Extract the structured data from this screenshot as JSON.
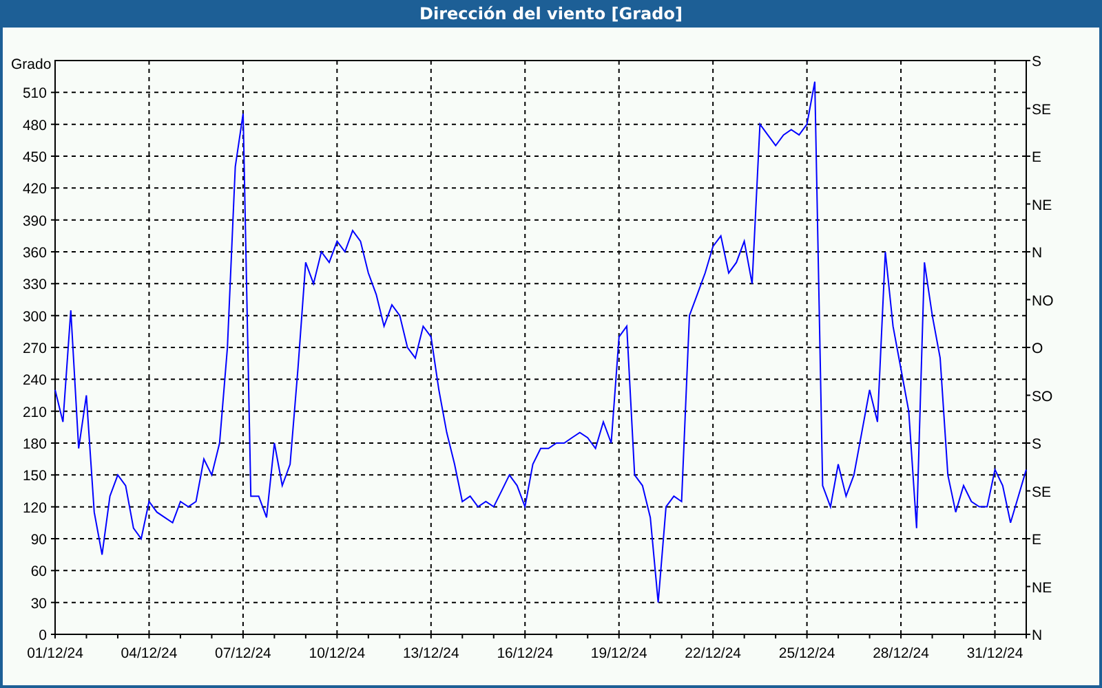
{
  "window": {
    "title": "Dirección del viento [Grado]"
  },
  "chart": {
    "right_axis_labels": [
      "S",
      "SE",
      "E",
      "NE",
      "N",
      "NO",
      "O",
      "SO",
      "S",
      "SE",
      "E",
      "NE",
      "N"
    ],
    "chart_data": {
      "type": "line",
      "ylabel": "Grado",
      "ylim": [
        0,
        540
      ],
      "grid": true,
      "categories": [
        "01/12/24",
        null,
        null,
        null,
        null,
        null,
        null,
        null,
        null,
        null,
        null,
        null,
        "04/12/24",
        null,
        null,
        null,
        null,
        null,
        null,
        null,
        null,
        null,
        null,
        null,
        "07/12/24",
        null,
        null,
        null,
        null,
        null,
        null,
        null,
        null,
        null,
        null,
        null,
        "10/12/24",
        null,
        null,
        null,
        null,
        null,
        null,
        null,
        null,
        null,
        null,
        null,
        "13/12/24",
        null,
        null,
        null,
        null,
        null,
        null,
        null,
        null,
        null,
        null,
        null,
        "16/12/24",
        null,
        null,
        null,
        null,
        null,
        null,
        null,
        null,
        null,
        null,
        null,
        "19/12/24",
        null,
        null,
        null,
        null,
        null,
        null,
        null,
        null,
        null,
        null,
        null,
        "22/12/24",
        null,
        null,
        null,
        null,
        null,
        null,
        null,
        null,
        null,
        null,
        null,
        "25/12/24",
        null,
        null,
        null,
        null,
        null,
        null,
        null,
        null,
        null,
        null,
        null,
        "28/12/24",
        null,
        null,
        null,
        null,
        null,
        null,
        null,
        null,
        null,
        null,
        null,
        "31/12/24",
        null,
        null,
        null,
        null
      ],
      "yticks": [
        0,
        30,
        60,
        90,
        120,
        150,
        180,
        210,
        240,
        270,
        300,
        330,
        360,
        390,
        420,
        450,
        480,
        510
      ],
      "series": [
        {
          "color": "#0000ff",
          "values": [
            230,
            200,
            305,
            175,
            225,
            115,
            75,
            130,
            150,
            140,
            100,
            90,
            125,
            115,
            110,
            105,
            125,
            120,
            125,
            165,
            150,
            180,
            270,
            440,
            490,
            130,
            130,
            110,
            180,
            140,
            160,
            250,
            350,
            330,
            360,
            350,
            370,
            360,
            380,
            370,
            340,
            320,
            290,
            310,
            300,
            270,
            260,
            290,
            280,
            230,
            190,
            160,
            125,
            130,
            120,
            125,
            120,
            135,
            150,
            140,
            120,
            160,
            175,
            175,
            180,
            180,
            185,
            190,
            185,
            175,
            200,
            180,
            280,
            290,
            150,
            140,
            110,
            30,
            120,
            130,
            125,
            300,
            320,
            340,
            365,
            375,
            340,
            350,
            370,
            330,
            480,
            470,
            460,
            470,
            475,
            470,
            480,
            520,
            140,
            120,
            160,
            130,
            150,
            190,
            230,
            200,
            360,
            290,
            250,
            210,
            100,
            350,
            300,
            260,
            150,
            115,
            140,
            125,
            120,
            120,
            155,
            140,
            105,
            130,
            155
          ]
        }
      ]
    }
  }
}
